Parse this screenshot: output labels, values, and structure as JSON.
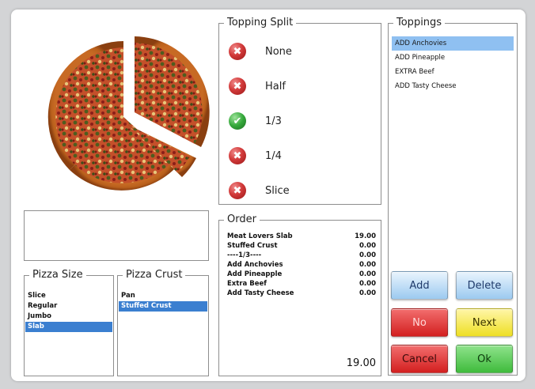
{
  "topping_split": {
    "legend": "Topping Split",
    "options": [
      {
        "label": "None",
        "state": "x"
      },
      {
        "label": "Half",
        "state": "x"
      },
      {
        "label": "1/3",
        "state": "check"
      },
      {
        "label": "1/4",
        "state": "x"
      },
      {
        "label": "Slice",
        "state": "x"
      }
    ]
  },
  "toppings": {
    "legend": "Toppings",
    "items": [
      "ADD Anchovies",
      "ADD Pineapple",
      "EXTRA Beef",
      "ADD Tasty Cheese"
    ],
    "selected_index": 0
  },
  "order": {
    "legend": "Order",
    "lines": [
      {
        "name": "Meat Lovers Slab",
        "price": "19.00"
      },
      {
        "name": "Stuffed Crust",
        "price": "0.00"
      },
      {
        "name": "----1/3----",
        "price": "0.00"
      },
      {
        "name": "Add Anchovies",
        "price": "0.00"
      },
      {
        "name": "Add Pineapple",
        "price": "0.00"
      },
      {
        "name": "Extra Beef",
        "price": "0.00"
      },
      {
        "name": "Add Tasty Cheese",
        "price": "0.00"
      }
    ],
    "total": "19.00"
  },
  "pizza_size": {
    "legend": "Pizza Size",
    "items": [
      "Slice",
      "Regular",
      "Jumbo",
      "Slab"
    ],
    "selected_index": 3
  },
  "pizza_crust": {
    "legend": "Pizza Crust",
    "items": [
      "Pan",
      "Stuffed Crust"
    ],
    "selected_index": 1
  },
  "buttons": {
    "add": "Add",
    "delete": "Delete",
    "no": "No",
    "next": "Next",
    "cancel": "Cancel",
    "ok": "Ok"
  },
  "icons": {
    "x": "x-circle-icon",
    "check": "check-circle-icon"
  },
  "colors": {
    "list_selection": "#3b7fd0",
    "toppings_selection": "#8fc0f1",
    "button_blue": "#9ccaf0",
    "button_red": "#d31f1f",
    "button_yellow": "#eedf24",
    "button_green": "#3fbb3c"
  }
}
